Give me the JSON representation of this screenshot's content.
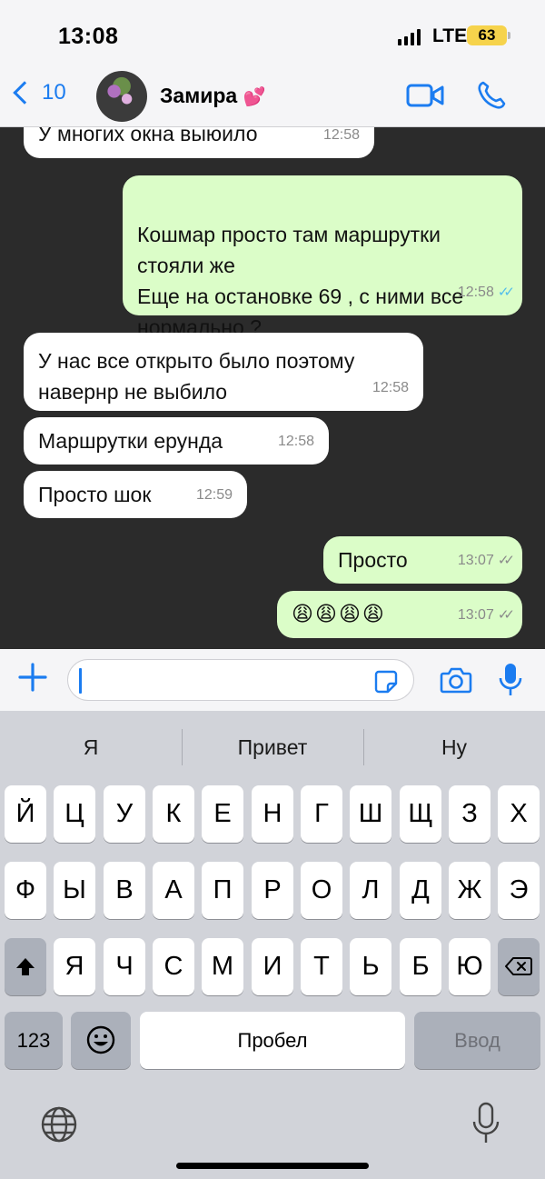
{
  "status": {
    "time": "13:08",
    "network": "LTE",
    "battery": "63"
  },
  "header": {
    "back_count": "10",
    "contact_name": "Замира",
    "contact_emoji": "💕"
  },
  "messages": [
    {
      "dir": "in",
      "text": "У многих окна выюило",
      "time": "12:58"
    },
    {
      "dir": "out",
      "text": "Кошмар просто там маршрутки стояли же\nЕще на остановке 69 , с ними все нормально ?",
      "time": "12:58",
      "ticks": "read"
    },
    {
      "dir": "in",
      "text": "У нас все открыто было поэтому навернр не выбило",
      "time": "12:58"
    },
    {
      "dir": "in",
      "text": "Маршрутки ерунда",
      "time": "12:58"
    },
    {
      "dir": "in",
      "text": "Просто шок",
      "time": "12:59"
    },
    {
      "dir": "out",
      "text": "Просто",
      "time": "13:07",
      "ticks": "delivered"
    },
    {
      "dir": "out",
      "text": "😩😩😩😩",
      "time": "13:07",
      "ticks": "delivered"
    }
  ],
  "input": {
    "placeholder": ""
  },
  "keyboard": {
    "suggestions": [
      "Я",
      "Привет",
      "Ну"
    ],
    "row1": [
      "Й",
      "Ц",
      "У",
      "К",
      "Е",
      "Н",
      "Г",
      "Ш",
      "Щ",
      "З",
      "Х"
    ],
    "row2": [
      "Ф",
      "Ы",
      "В",
      "А",
      "П",
      "Р",
      "О",
      "Л",
      "Д",
      "Ж",
      "Э"
    ],
    "row3": [
      "Я",
      "Ч",
      "С",
      "М",
      "И",
      "Т",
      "Ь",
      "Б",
      "Ю"
    ],
    "numbers_label": "123",
    "space_label": "Пробел",
    "return_label": "Ввод"
  },
  "colors": {
    "accent": "#1b7cf0",
    "outgoing": "#dbfdc8",
    "chat_bg": "#2b2b2b",
    "read_ticks": "#53bdeb"
  }
}
